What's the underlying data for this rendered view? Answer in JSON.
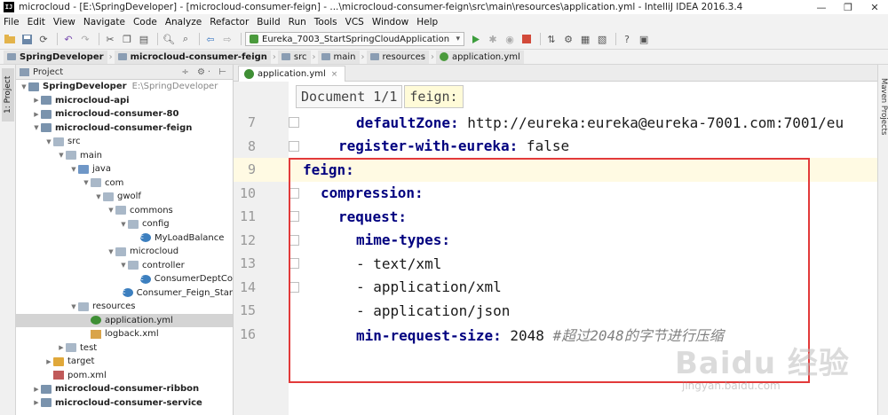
{
  "window": {
    "icon_text": "IJ",
    "title": "microcloud - [E:\\SpringDeveloper] - [microcloud-consumer-feign] - ...\\microcloud-consumer-feign\\src\\main\\resources\\application.yml - IntelliJ IDEA 2016.3.4",
    "minimize": "—",
    "maximize": "❐",
    "close": "✕"
  },
  "menu": [
    "File",
    "Edit",
    "View",
    "Navigate",
    "Code",
    "Analyze",
    "Refactor",
    "Build",
    "Run",
    "Tools",
    "VCS",
    "Window",
    "Help"
  ],
  "toolbar": {
    "run_config": "Eureka_7003_StartSpringCloudApplication"
  },
  "breadcrumb": [
    "SpringDeveloper",
    "microcloud-consumer-feign",
    "src",
    "main",
    "resources",
    "application.yml"
  ],
  "left_stripe": {
    "tab": "1: Project"
  },
  "right_stripe": {
    "tab": "Maven Projects"
  },
  "project_panel": {
    "title": "Project",
    "tools": "÷ ⚙· ⊢",
    "tree": [
      {
        "label": "SpringDeveloper",
        "extra": "E:\\SpringDeveloper",
        "depth": 0,
        "arrow": "▼",
        "icon": "module",
        "bold": true
      },
      {
        "label": "microcloud-api",
        "depth": 1,
        "arrow": "▶",
        "icon": "module",
        "bold": true
      },
      {
        "label": "microcloud-consumer-80",
        "depth": 1,
        "arrow": "▶",
        "icon": "module",
        "bold": true
      },
      {
        "label": "microcloud-consumer-feign",
        "depth": 1,
        "arrow": "▼",
        "icon": "module",
        "bold": true
      },
      {
        "label": "src",
        "depth": 2,
        "arrow": "▼",
        "icon": "folder"
      },
      {
        "label": "main",
        "depth": 3,
        "arrow": "▼",
        "icon": "folder"
      },
      {
        "label": "java",
        "depth": 4,
        "arrow": "▼",
        "icon": "srcfolder"
      },
      {
        "label": "com",
        "depth": 5,
        "arrow": "▼",
        "icon": "folder"
      },
      {
        "label": "gwolf",
        "depth": 6,
        "arrow": "▼",
        "icon": "folder"
      },
      {
        "label": "commons",
        "depth": 7,
        "arrow": "▼",
        "icon": "folder"
      },
      {
        "label": "config",
        "depth": 8,
        "arrow": "▼",
        "icon": "folder"
      },
      {
        "label": "MyLoadBalance",
        "depth": 9,
        "arrow": "",
        "icon": "class"
      },
      {
        "label": "microcloud",
        "depth": 7,
        "arrow": "▼",
        "icon": "folder"
      },
      {
        "label": "controller",
        "depth": 8,
        "arrow": "▼",
        "icon": "folder"
      },
      {
        "label": "ConsumerDeptCo",
        "depth": 9,
        "arrow": "",
        "icon": "class"
      },
      {
        "label": "Consumer_Feign_Star",
        "depth": 8,
        "arrow": "",
        "icon": "class"
      },
      {
        "label": "resources",
        "depth": 4,
        "arrow": "▼",
        "icon": "resfolder"
      },
      {
        "label": "application.yml",
        "depth": 5,
        "arrow": "",
        "icon": "yml",
        "selected": true
      },
      {
        "label": "logback.xml",
        "depth": 5,
        "arrow": "",
        "icon": "xml"
      },
      {
        "label": "test",
        "depth": 3,
        "arrow": "▶",
        "icon": "folder"
      },
      {
        "label": "target",
        "depth": 2,
        "arrow": "▶",
        "icon": "orange"
      },
      {
        "label": "pom.xml",
        "depth": 2,
        "arrow": "",
        "icon": "m"
      },
      {
        "label": "microcloud-consumer-ribbon",
        "depth": 1,
        "arrow": "▶",
        "icon": "module",
        "bold": true
      },
      {
        "label": "microcloud-consumer-service",
        "depth": 1,
        "arrow": "▶",
        "icon": "module",
        "bold": true
      }
    ]
  },
  "editor": {
    "tab_label": "application.yml",
    "tab_close": "×",
    "code_breadcrumb": [
      "Document 1/1",
      "feign:"
    ],
    "lines": [
      {
        "num": "7",
        "indent": "      ",
        "key": "defaultZone:",
        "value": " http://eureka:eureka@eureka-7001.com:7001/eu",
        "comment": ""
      },
      {
        "num": "8",
        "indent": "    ",
        "key": "register-with-eureka:",
        "value": " false",
        "comment": ""
      },
      {
        "num": "9",
        "indent": "",
        "key": "feign:",
        "value": "",
        "comment": "",
        "current": true
      },
      {
        "num": "10",
        "indent": "  ",
        "key": "compression:",
        "value": "",
        "comment": ""
      },
      {
        "num": "11",
        "indent": "    ",
        "key": "request:",
        "value": "",
        "comment": ""
      },
      {
        "num": "12",
        "indent": "      ",
        "key": "mime-types:",
        "value": "",
        "comment": ""
      },
      {
        "num": "13",
        "indent": "      ",
        "key": "",
        "value": "- text/xml",
        "comment": ""
      },
      {
        "num": "14",
        "indent": "      ",
        "key": "",
        "value": "- application/xml",
        "comment": ""
      },
      {
        "num": "15",
        "indent": "      ",
        "key": "",
        "value": "- application/json",
        "comment": ""
      },
      {
        "num": "16",
        "indent": "      ",
        "key": "min-request-size:",
        "value": " 2048 ",
        "comment": "#超过2048的字节进行压缩"
      }
    ]
  },
  "watermark": {
    "logo": "Baidu 经验",
    "sub": "jingyan.baidu.com"
  }
}
